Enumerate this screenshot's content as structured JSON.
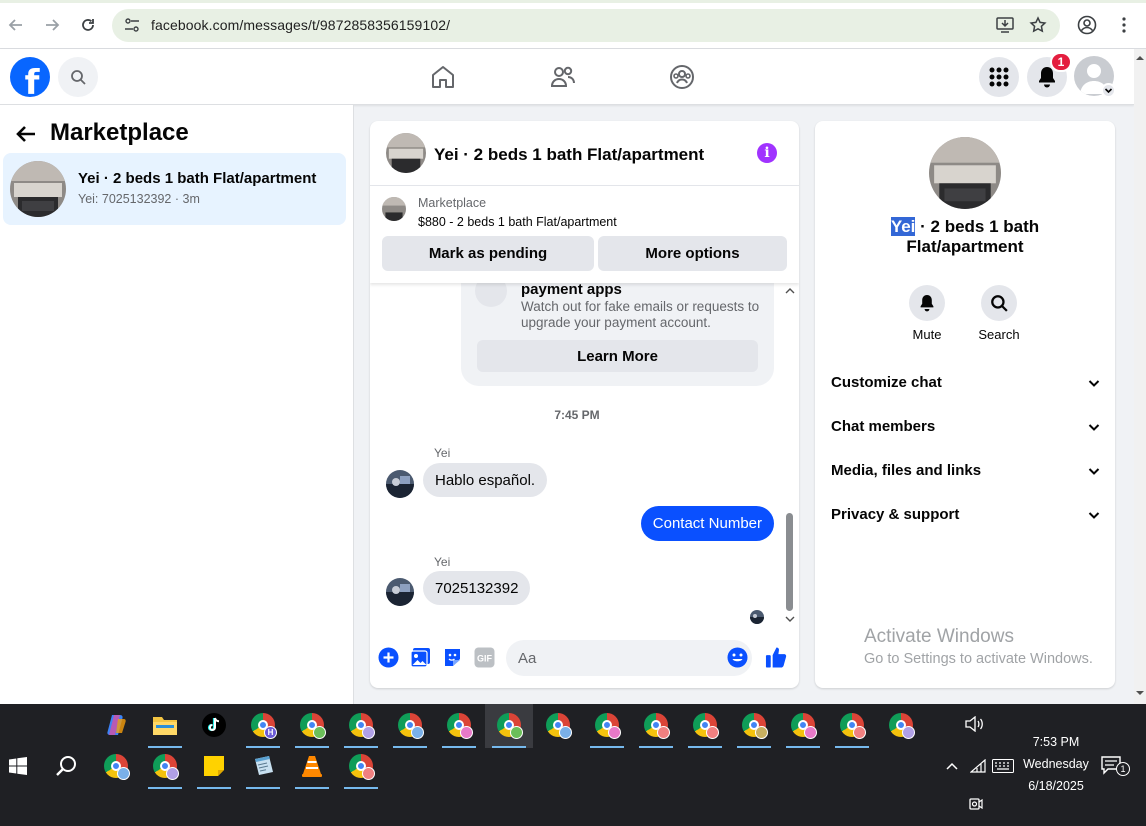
{
  "browser": {
    "url": "facebook.com/messages/t/9872858356159102/"
  },
  "header": {
    "logo_letter": "f",
    "notification_count": "1"
  },
  "sidebar": {
    "title": "Marketplace",
    "conversation": {
      "name": "Yei · 2 beds 1 bath Flat/apartment",
      "subtitle": "Yei: 7025132392 · 3m"
    }
  },
  "chat": {
    "title": "Yei · 2 beds 1 bath Flat/apartment",
    "listing_label": "Marketplace",
    "listing_price": "$880 - 2 beds 1 bath Flat/apartment",
    "mark_pending_label": "Mark as pending",
    "more_options_label": "More options",
    "safety_title": "payment apps",
    "safety_body": "Watch out for fake emails or requests to upgrade your payment account.",
    "learn_more_label": "Learn More",
    "timestamp": "7:45 PM",
    "messages": [
      {
        "sender": "Yei",
        "text": "Hablo español."
      },
      {
        "sender": "me",
        "text": "Contact Number"
      },
      {
        "sender": "Yei",
        "text": "7025132392"
      }
    ],
    "composer_placeholder": "Aa",
    "accent_color": "#0a50ff"
  },
  "details": {
    "title_highlight": "Yei",
    "title_rest": " · 2 beds 1 bath Flat/apartment",
    "mute_label": "Mute",
    "search_label": "Search",
    "sections": [
      "Customize chat",
      "Chat members",
      "Media, files and links",
      "Privacy & support"
    ]
  },
  "watermark": {
    "line1": "Activate Windows",
    "line2": "Go to Settings to activate Windows."
  },
  "taskbar": {
    "time": "7:53 PM",
    "day": "Wednesday",
    "date": "6/18/2025",
    "notification_count": "1",
    "copilot_icon": "copilot-icon",
    "file_explorer_icon": "folder-icon",
    "tiktok_icon": "tiktok-icon",
    "chrome_profile_badge_letter": "H"
  }
}
